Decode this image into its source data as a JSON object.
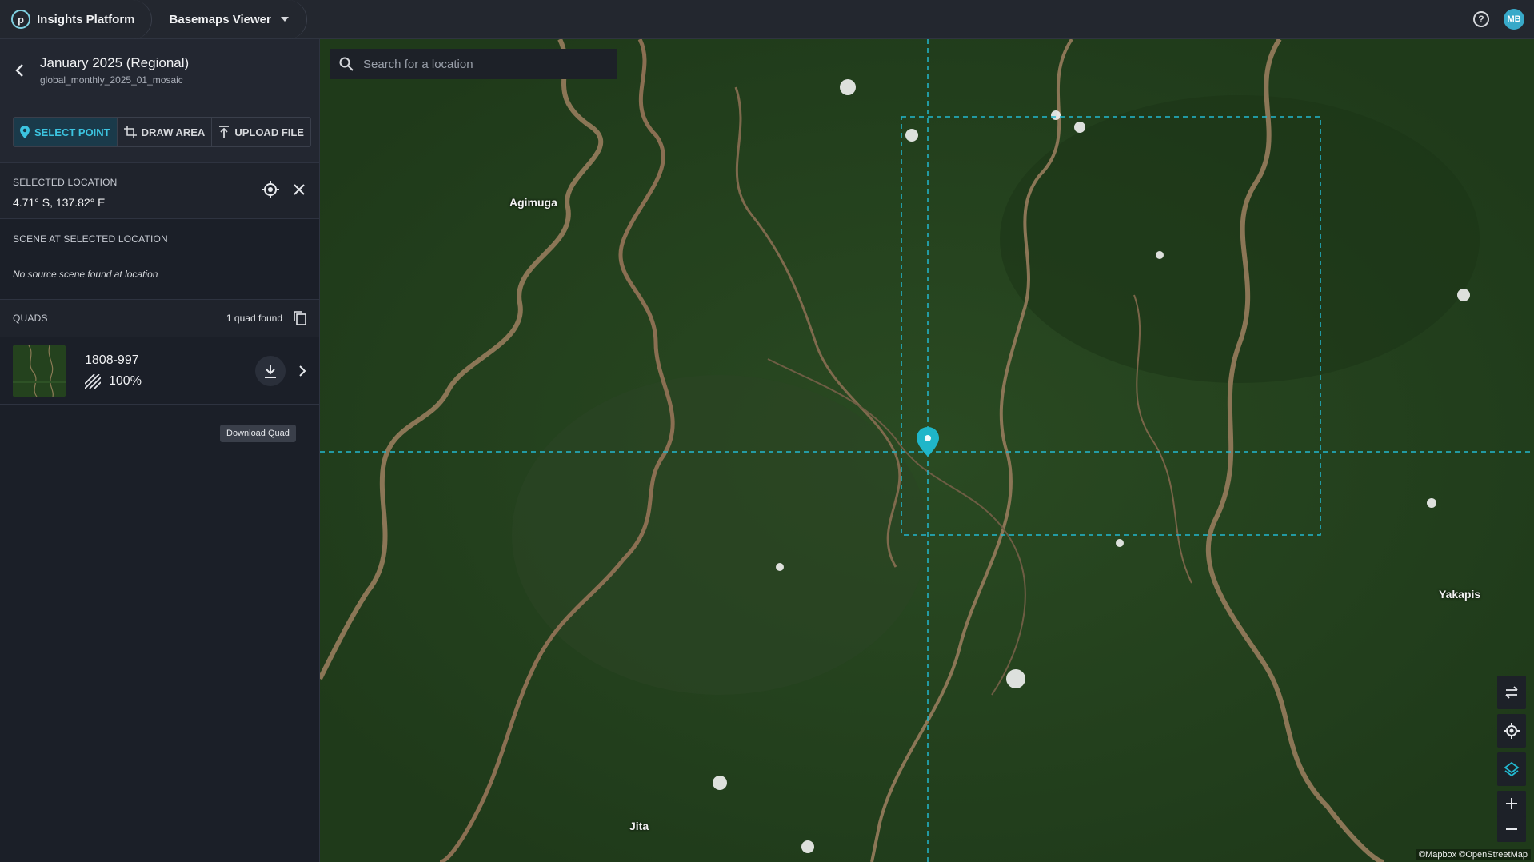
{
  "topbar": {
    "brand_letter": "p",
    "brand_name": "Insights Platform",
    "app_name": "Basemaps Viewer",
    "avatar_initials": "MB"
  },
  "sidebar": {
    "title": "January 2025 (Regional)",
    "subtitle": "global_monthly_2025_01_mosaic",
    "tools": {
      "select_point": "SELECT POINT",
      "draw_area": "DRAW AREA",
      "upload_file": "UPLOAD FILE"
    },
    "selected_location": {
      "label": "SELECTED LOCATION",
      "coords": "4.71° S, 137.82° E"
    },
    "scene": {
      "label": "SCENE AT SELECTED LOCATION",
      "message": "No source scene found at location"
    },
    "quads": {
      "label": "QUADS",
      "count": "1 quad found",
      "items": [
        {
          "id": "1808-997",
          "coverage": "100%"
        }
      ],
      "download_tooltip": "Download Quad"
    }
  },
  "map": {
    "search_placeholder": "Search for a location",
    "places": [
      "Agimuga",
      "Yakapis",
      "Jita"
    ],
    "attribution": "©Mapbox ©OpenStreetMap",
    "accent_color": "#22b8cf"
  }
}
